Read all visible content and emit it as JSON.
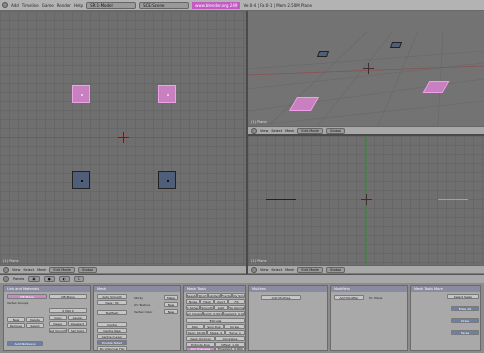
{
  "topbar": {
    "menus": [
      "Add",
      "Timeline",
      "Game",
      "Render",
      "Help"
    ],
    "screen_field": "SR:1-Model",
    "scene_field": "SCE:Scene",
    "info_label": "www.blender.org 249",
    "stats": "Ve:0-4 | Fa:0-1 | Mem 2.50M Plane"
  },
  "viewports": {
    "top_left": {
      "label": "(1) Plane"
    },
    "top_right": {
      "label": "(1) Plane"
    },
    "bottom_right": {
      "label": "(1) Plane"
    }
  },
  "vp_header_left": {
    "view": "View",
    "select": "Select",
    "mesh": "Mesh",
    "mode": "Edit Mode",
    "global": "Global"
  },
  "vp_header_right_top": {
    "view": "View",
    "select": "Select",
    "mesh": "Mesh",
    "mode": "Edit Mode",
    "global": "Global"
  },
  "vp_header_right_bottom": {
    "view": "View",
    "select": "Select",
    "mesh": "Mesh",
    "mode": "Edit Mode",
    "global": "Global"
  },
  "buttons_header": {
    "panels": "Panels",
    "frame": "1"
  },
  "panels": {
    "link_materials": {
      "title": "Link and Materials",
      "me_field": "ME:Plane",
      "ob_field": "OB:Plane",
      "vertex_groups": "Vertex Groups",
      "mat_field": "0 Mat 0",
      "buttons": [
        "New",
        "Delete",
        "Copy",
        "Assign",
        "Remove",
        "Select",
        "Desel.",
        "Deselect",
        "Set Smooth",
        "Set Solid"
      ],
      "autotex": "AutoTexSpace"
    },
    "mesh": {
      "title": "Mesh",
      "auto_smooth": "Auto Smooth",
      "degr": "Degr: 30",
      "sticky": "Sticky",
      "uv_texture": "UV Texture",
      "vertex_color": "Vertex Color",
      "make": "Make",
      "new": "New",
      "center": "Centre",
      "center_new": "Centre New",
      "center_cursor": "Centre Cursor",
      "double_sided": "Double Sided",
      "no_vnormal_flip": "No V.Normal Flip",
      "texmesh": "TexMesh"
    },
    "multires": {
      "title": "Multires",
      "add_multires": "Add Multires"
    },
    "modifiers": {
      "title": "Modifiers",
      "add_modifier": "Add Modifier",
      "to": "To: Plane"
    },
    "mesh_tools": {
      "title": "Mesh Tools",
      "row1": [
        "Beauty",
        "Short",
        "Subdivide",
        "Fractal",
        "Subdiv Smooth"
      ],
      "row2": [
        "Noise",
        "Hash",
        "Xsort",
        "Fill"
      ],
      "row3": [
        "To Sphere",
        "Smooth",
        "Split",
        "Flip Normal"
      ],
      "row4": [
        "Rem Doubles",
        "Limit: 0.001",
        "Threshold: 0.001"
      ],
      "extrude": "Extrude",
      "spin": "Spin",
      "spin_dup": "Spin Dup",
      "screw": "Screw",
      "degr": "Degr: 90.00",
      "steps": "Steps: 9",
      "turns": "Turns: 1",
      "keep_original": "Keep Original",
      "clockwise": "Clockwise",
      "extrude_dup": "Extrude Dup",
      "offset": "Offset: 1.00",
      "join_triangles": "Join Triangles",
      "threshold": "Threshold: 0.800"
    },
    "mesh_tools_more": {
      "title": "Mesh Tools More",
      "select_swap": "Select Swap",
      "tabs": [
        "Edge Alt",
        "Draw",
        "Faces"
      ]
    }
  }
}
